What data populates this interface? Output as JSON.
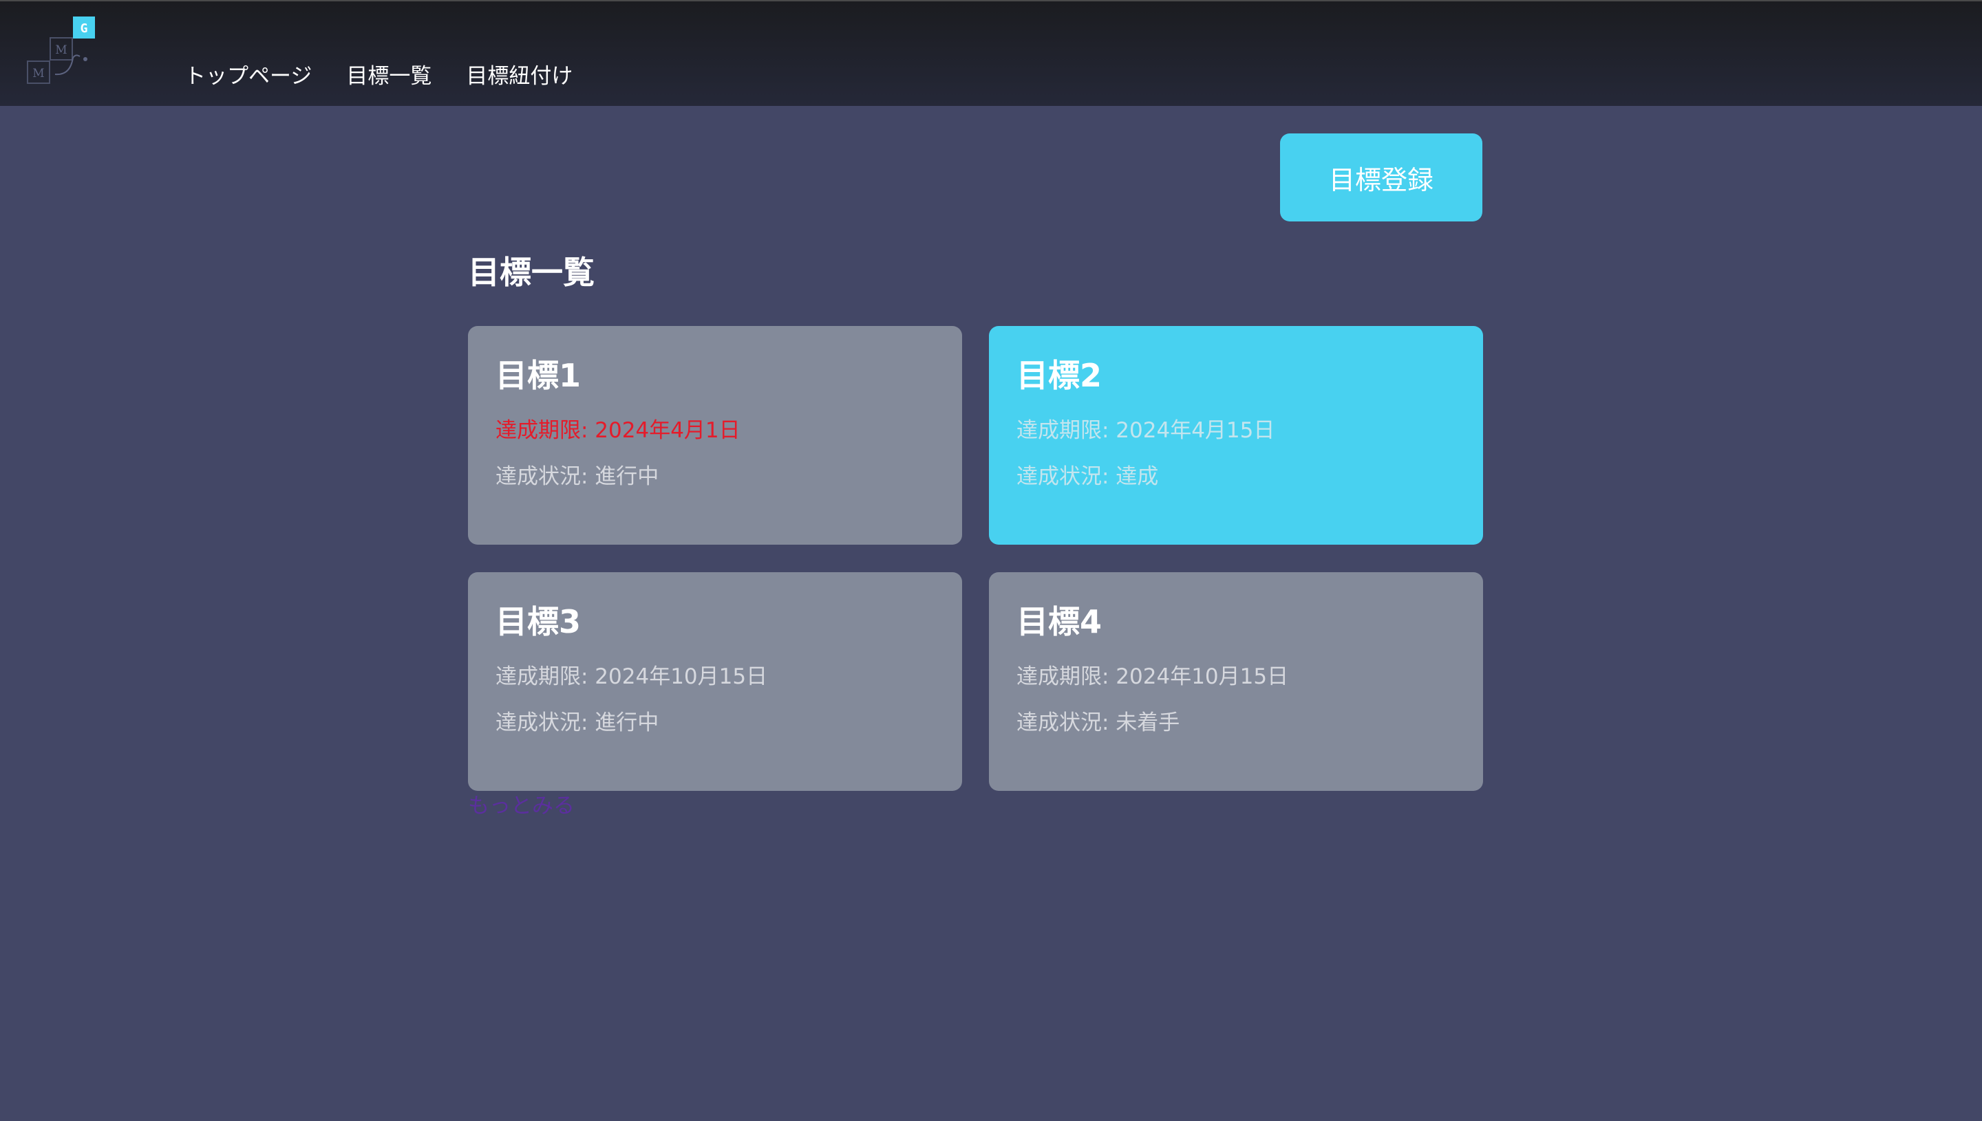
{
  "header": {
    "logo": {
      "letters": [
        "G",
        "M",
        "M"
      ],
      "accent_color": "#48d1f0"
    },
    "nav": [
      {
        "label": "トップページ"
      },
      {
        "label": "目標一覧"
      },
      {
        "label": "目標紐付け"
      }
    ]
  },
  "main": {
    "register_button_label": "目標登録",
    "title": "目標一覧",
    "goals": [
      {
        "title": "目標1",
        "deadline": "達成期限: 2024年4月1日",
        "status": "達成状況: 進行中",
        "overdue": true,
        "achieved": false
      },
      {
        "title": "目標2",
        "deadline": "達成期限: 2024年4月15日",
        "status": "達成状況: 達成",
        "overdue": false,
        "achieved": true
      },
      {
        "title": "目標3",
        "deadline": "達成期限: 2024年10月15日",
        "status": "達成状況: 進行中",
        "overdue": false,
        "achieved": false
      },
      {
        "title": "目標4",
        "deadline": "達成期限: 2024年10月15日",
        "status": "達成状況: 未着手",
        "overdue": false,
        "achieved": false
      }
    ],
    "more_link": "もっとみる"
  },
  "colors": {
    "background": "#434766",
    "accent": "#48d1f0",
    "card": "#838a9a",
    "overdue": "#e51b2a",
    "link": "#5b2f9e"
  }
}
